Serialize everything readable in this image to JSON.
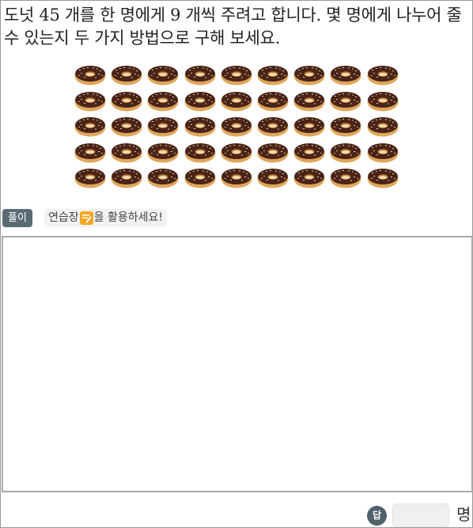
{
  "question": {
    "text": "도넛 45 개를 한 명에게 9 개씩 주려고 합니다. 몇 명에게 나누어 줄 수 있는지 두 가지 방법으로 구해 보세요."
  },
  "donuts": {
    "rows": 5,
    "columns": 9,
    "total": 45,
    "icon": "chocolate-donut-icon",
    "colors": {
      "frosting": "#4a2417",
      "dough": "#e0a65a",
      "sprinkle": "#f3e2c3"
    }
  },
  "solve_label": "풀이",
  "hint": {
    "before_icon": "연습장",
    "icon": "memo-pencil-icon",
    "after_icon": "을 활용하세요!"
  },
  "answer": {
    "badge": "답",
    "value": "",
    "unit": "명"
  },
  "colors": {
    "tag_bg": "#5a6b75",
    "badge_bg": "#51616b",
    "memo": "#f6a623"
  }
}
